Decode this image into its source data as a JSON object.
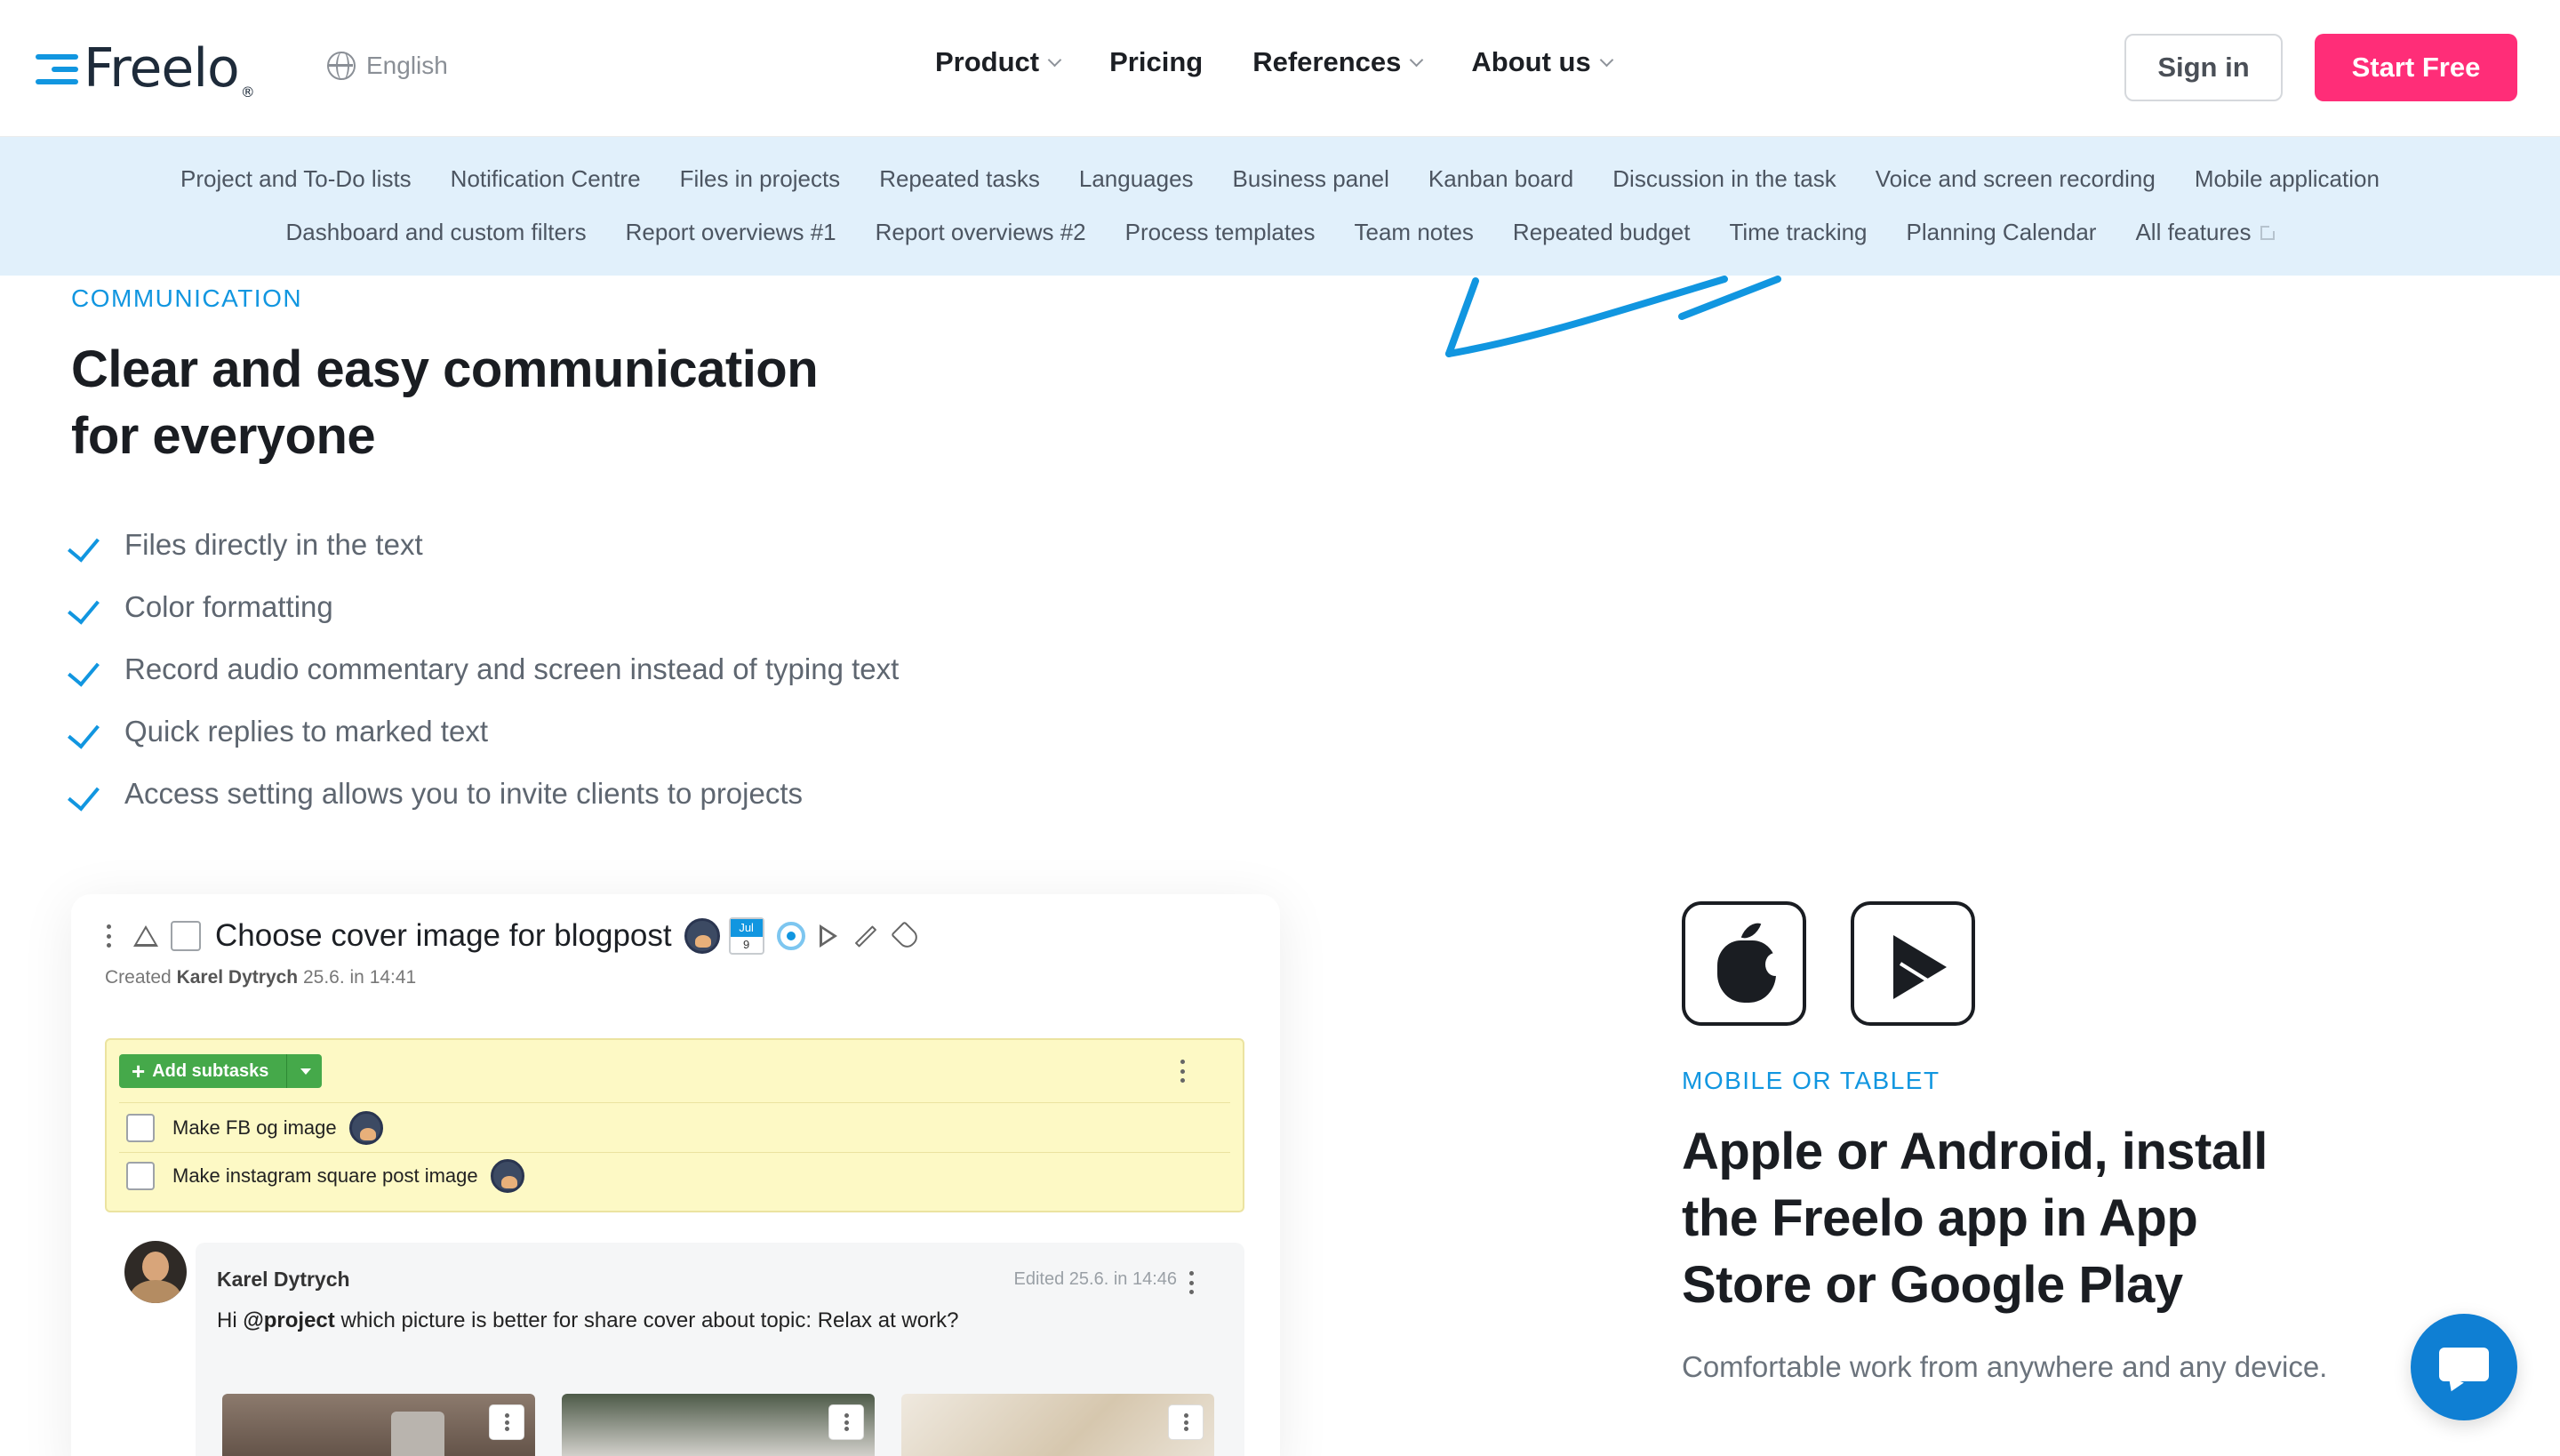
{
  "header": {
    "logo_text": "Freelo",
    "logo_mark": "®",
    "language": "English",
    "nav": [
      {
        "label": "Product",
        "has_dropdown": true
      },
      {
        "label": "Pricing",
        "has_dropdown": false
      },
      {
        "label": "References",
        "has_dropdown": true
      },
      {
        "label": "About us",
        "has_dropdown": true
      }
    ],
    "signin_label": "Sign in",
    "start_label": "Start Free"
  },
  "features_nav": {
    "row1": [
      "Project and To-Do lists",
      "Notification Centre",
      "Files in projects",
      "Repeated tasks",
      "Languages",
      "Business panel",
      "Kanban board",
      "Discussion in the task",
      "Voice and screen recording",
      "Mobile application"
    ],
    "row2": [
      "Dashboard and custom filters",
      "Report overviews #1",
      "Report overviews #2",
      "Process templates",
      "Team notes",
      "Repeated budget",
      "Time tracking",
      "Planning Calendar",
      "All features"
    ]
  },
  "communication": {
    "eyebrow": "COMMUNICATION",
    "headline_line1": "Clear and easy communication",
    "headline_line2": "for everyone",
    "bullets": [
      "Files directly in the text",
      "Color formatting",
      "Record audio commentary and screen instead of typing text",
      "Quick replies to marked text",
      "Access setting allows you to invite clients to projects"
    ]
  },
  "task_card": {
    "title": "Choose cover image for blogpost",
    "calendar_month": "Jul",
    "calendar_day": "9",
    "created_prefix": "Created",
    "created_by": "Karel Dytrych",
    "created_when": "25.6. in 14:41",
    "add_subtasks_label": "Add subtasks",
    "subtasks": [
      "Make FB og image",
      "Make instagram square post image"
    ],
    "comment": {
      "author": "Karel Dytrych",
      "edited": "Edited 25.6. in 14:46",
      "text_prefix": "Hi",
      "mention": "@project",
      "text_suffix": "which picture is better for share cover about topic: Relax at work?"
    }
  },
  "mobile": {
    "eyebrow": "MOBILE OR TABLET",
    "headline_line1": "Apple or Android, install",
    "headline_line2": "the Freelo app in App",
    "headline_line3": "Store or Google Play",
    "paragraph": "Comfortable work from anywhere and any device."
  },
  "colors": {
    "accent_blue": "#1196e0",
    "cta_pink": "#ff2d78",
    "feature_bar_bg": "#e1f0fb",
    "subtask_bg": "#fdf9c5",
    "subtask_button": "#45a94a",
    "chat_bubble": "#0f7fd3"
  },
  "icons": {
    "language": "globe-icon",
    "nav_dropdown": "chevron-down-icon",
    "checklist": "check-icon",
    "external": "external-link-icon",
    "apple_store": "apple-icon",
    "google_play": "google-play-icon",
    "chat": "chat-icon"
  }
}
